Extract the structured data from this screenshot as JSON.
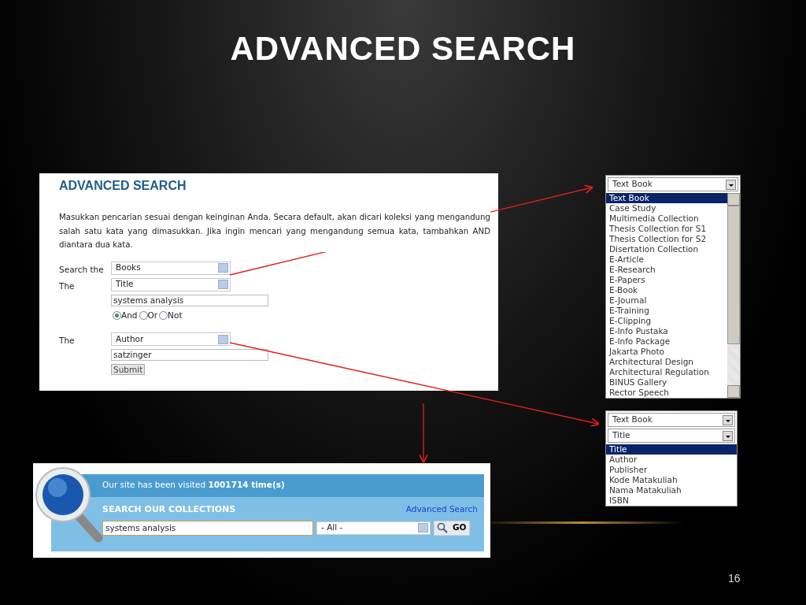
{
  "slide": {
    "title": "ADVANCED SEARCH",
    "page_number": "16"
  },
  "advanced_search_panel": {
    "heading": "ADVANCED SEARCH",
    "description": "Masukkan pencarian sesuai dengan keinginan Anda. Secara default, akan dicari koleksi yang mengandung salah satu kata yang dimasukkan. Jika ingin mencari yang mengandung semua kata, tambahkan AND diantara dua kata.",
    "rows": [
      {
        "label": "Search the",
        "select": "Books"
      },
      {
        "label": "The",
        "select": "Title",
        "value": "systems analysis",
        "operators": [
          {
            "label": "And",
            "selected": true
          },
          {
            "label": "Or",
            "selected": false
          },
          {
            "label": "Not",
            "selected": false
          }
        ]
      },
      {
        "label": "The",
        "select": "Author",
        "value": "satzinger"
      }
    ],
    "submit": "Submit"
  },
  "collection_dropdown": {
    "select": "Text Book",
    "options": [
      {
        "label": "Text Book",
        "selected": true
      },
      {
        "label": "Case Study",
        "selected": false
      },
      {
        "label": "Multimedia Collection",
        "selected": false
      },
      {
        "label": "Thesis Collection for S1",
        "selected": false
      },
      {
        "label": "Thesis Collection for S2",
        "selected": false
      },
      {
        "label": "Disertation Collection",
        "selected": false
      },
      {
        "label": "E-Article",
        "selected": false
      },
      {
        "label": "E-Research",
        "selected": false
      },
      {
        "label": "E-Papers",
        "selected": false
      },
      {
        "label": "E-Book",
        "selected": false
      },
      {
        "label": "E-Journal",
        "selected": false
      },
      {
        "label": "E-Training",
        "selected": false
      },
      {
        "label": "E-Clipping",
        "selected": false
      },
      {
        "label": "E-Info Pustaka",
        "selected": false
      },
      {
        "label": "E-Info Package",
        "selected": false
      },
      {
        "label": "Jakarta Photo",
        "selected": false
      },
      {
        "label": "Architectural Design",
        "selected": false
      },
      {
        "label": "Architectural Regulation",
        "selected": false
      },
      {
        "label": "BINUS Gallery",
        "selected": false
      },
      {
        "label": "Rector Speech",
        "selected": false
      }
    ]
  },
  "field_dropdown": {
    "collection_select": "Text Book",
    "select": "Title",
    "options": [
      {
        "label": "Title",
        "selected": true
      },
      {
        "label": "Author",
        "selected": false
      },
      {
        "label": "Publisher",
        "selected": false
      },
      {
        "label": "Kode Matakuliah",
        "selected": false
      },
      {
        "label": "Nama Matakuliah",
        "selected": false
      },
      {
        "label": "ISBN",
        "selected": false
      }
    ]
  },
  "search_widget": {
    "visits": "Our site has been visited **1001714 time(s)**",
    "heading": "SEARCH OUR COLLECTIONS",
    "advanced_link": "Advanced Search",
    "query": "systems analysis",
    "category": "- All -",
    "go": "GO"
  }
}
